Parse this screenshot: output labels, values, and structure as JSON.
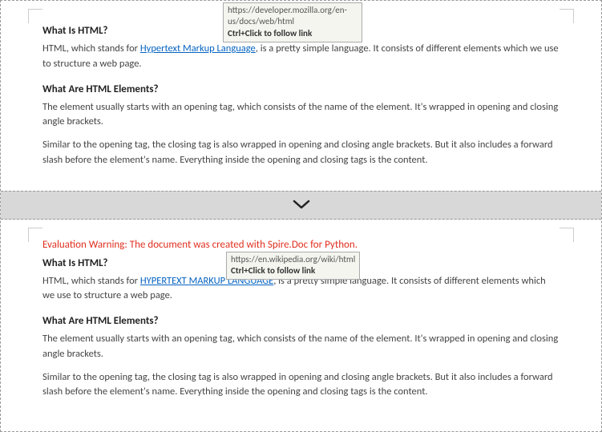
{
  "page1": {
    "heading1": "What Is HTML?",
    "para1_pre": "HTML, which stands for ",
    "link_text": "Hypertext Markup Language",
    "para1_post": ", is a pretty simple language. It consists of different elements which we use to structure a web page.",
    "heading2": "What Are HTML Elements?",
    "para2": "The element usually starts with an opening tag, which consists of the name of the element. It's wrapped in opening and closing angle brackets.",
    "para3": "Similar to the opening tag, the closing tag is also wrapped in opening and closing angle brackets. But it also includes a forward slash before the element's name. Everything inside the opening and closing tags is the content.",
    "tooltip": {
      "url": "https://developer.mozilla.org/en-us/docs/web/html",
      "hint": "Ctrl+Click to follow link"
    }
  },
  "page2": {
    "warning": "Evaluation Warning: The document was created with Spire.Doc for Python.",
    "heading1": "What Is HTML?",
    "para1_pre": "HTML, which stands for ",
    "link_text": "HYPERTEXT MARKUP LANGUAGE",
    "para1_post": ", is a pretty simple language. It consists of different elements which we use to structure a web page.",
    "heading2": "What Are HTML Elements?",
    "para2": "The element usually starts with an opening tag, which consists of the name of the element. It's wrapped in opening and closing angle brackets.",
    "para3": "Similar to the opening tag, the closing tag is also wrapped in opening and closing angle brackets. But it also includes a forward slash before the element's name. Everything inside the opening and closing tags is the content.",
    "tooltip": {
      "url": "https://en.wikipedia.org/wiki/html",
      "hint": "Ctrl+Click to follow link"
    }
  }
}
